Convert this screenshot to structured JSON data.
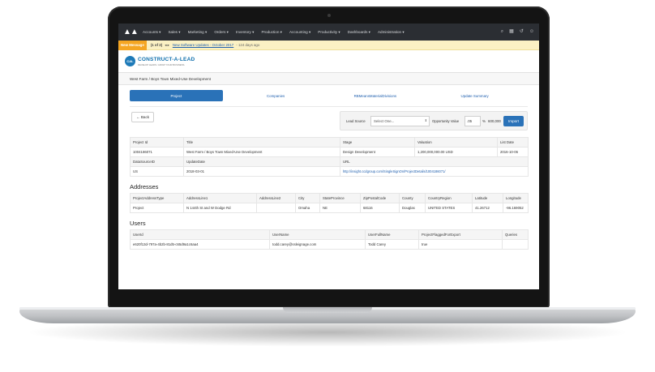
{
  "nav": {
    "menu": [
      "Accounts ▾",
      "Sales ▾",
      "Marketing ▾",
      "Orders ▾",
      "Inventory ▾",
      "Production ▾",
      "Accounting ▾",
      "Productivity ▾",
      "Dashboards ▾",
      "Administration ▾"
    ]
  },
  "banner": {
    "tag": "New Message",
    "count": "(1 of 2)",
    "arrows": "◂ ▸",
    "link": "New Software Updates - October 2017",
    "age": "- 124 days ago"
  },
  "brand": {
    "name": "CONSTRUCT-A-LEAD",
    "tagline": "DEVELOP LEADS. GROW YOUR BUSINESS.",
    "badge": "CAL"
  },
  "breadcrumb": "West Farm / Boys Town Mixed-Use Development",
  "tabs": [
    "Project",
    "Companies",
    "RBMeansMaterialDivisions",
    "Update Summary"
  ],
  "toolbar": {
    "back_label": "← Back",
    "lead_source_label": "Lead Source",
    "lead_source_value": "Select One...",
    "opportunity_label": "Opportunity Value",
    "opportunity_value": ".05",
    "percent": "%",
    "amount": "600,000",
    "import_label": "Import"
  },
  "project": {
    "rows": [
      [
        "Project Id",
        "Title",
        "Stage",
        "Valuation",
        "List Date"
      ],
      [
        "1004186071",
        "West Farm / Boys Town Mixed-Use Development",
        "Design Development",
        "1,200,000,000.00 USD",
        "2016-10-06"
      ],
      [
        "DataSourceID",
        "UpdateDate",
        "URL",
        "",
        ""
      ],
      [
        "US",
        "2018-03-01",
        "http://insight.ccdgroup.com/SingleSignOn/ProjectDetails/1004186071/",
        "",
        ""
      ]
    ]
  },
  "addresses": {
    "title": "Addresses",
    "headers": [
      "ProjectAddressType",
      "AddressLine1",
      "AddressLine2",
      "City",
      "StateProvince",
      "ZipPostalCode",
      "County",
      "CountryRegion",
      "Latitude",
      "Longitude"
    ],
    "rows": [
      [
        "Project",
        "N 144th St and W Dodge Rd",
        "",
        "Omaha",
        "NE",
        "68116",
        "Douglas",
        "UNITED STATES",
        "41.26712",
        "-96.169052"
      ]
    ]
  },
  "users": {
    "title": "Users",
    "headers": [
      "UserId",
      "UserName",
      "UserFullName",
      "ProjectFlaggedForExport",
      "Queries"
    ],
    "rows": [
      [
        "e620f13d-797a-4b2b-81d5-c65d9a1c6aa4",
        "todd.carey@ssleignage.com",
        "Todd Carey",
        "true",
        ""
      ]
    ]
  }
}
